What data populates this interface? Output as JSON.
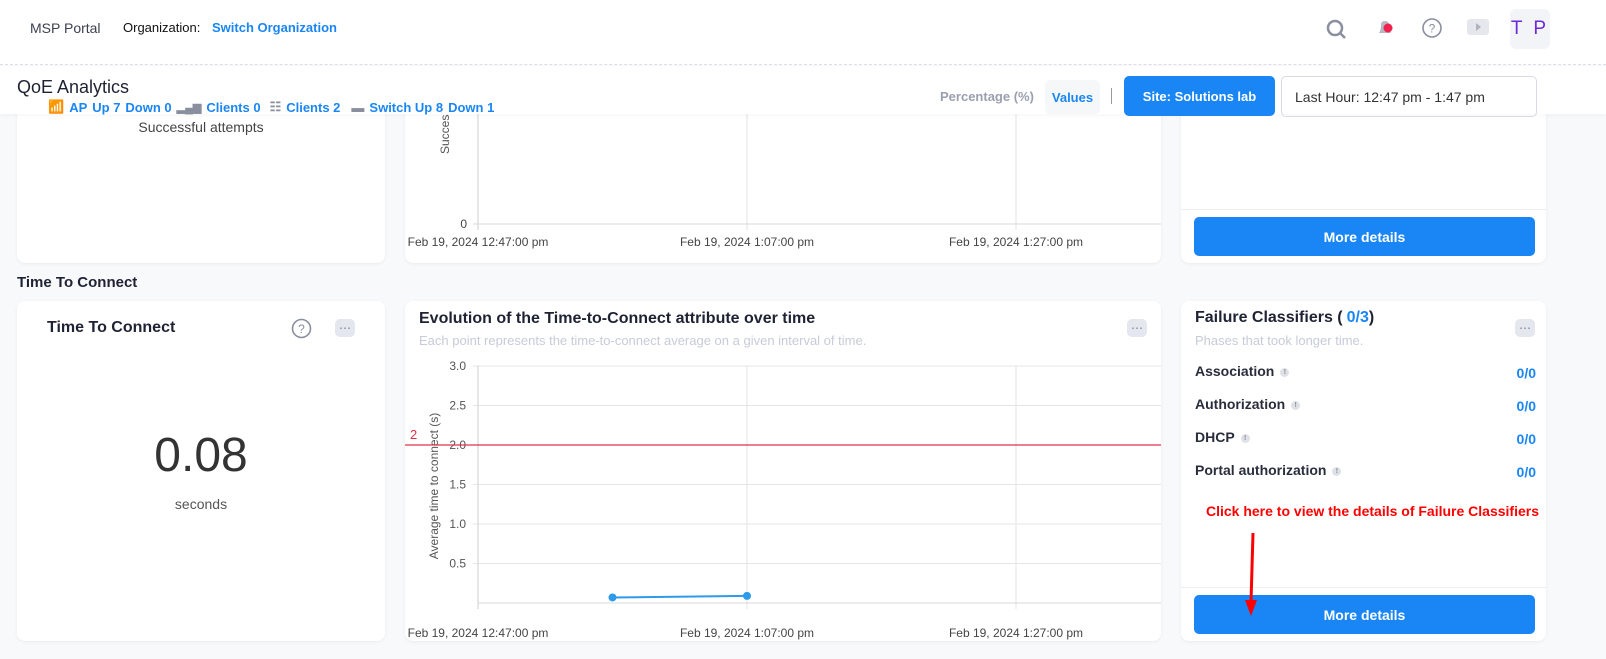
{
  "header": {
    "app": "MSP Portal",
    "org_label": "Organization:",
    "org_link": "Switch Organization",
    "avatar": "T P"
  },
  "subheader": {
    "title": "QoE Analytics",
    "stats": {
      "ap": "AP",
      "ap_up": "Up 7",
      "ap_down": "Down 0",
      "clients_wireless": "Clients 0",
      "clients_wired": "Clients 2",
      "switch_up": "Switch Up 8",
      "switch_down": "Down 1"
    },
    "toggle_percentage": "Percentage (%)",
    "toggle_values": "Values",
    "site_button": "Site: Solutions lab",
    "time_range": "Last Hour: 12:47 pm - 1:47 pm"
  },
  "top_row": {
    "left_caption": "Successful attempts",
    "chart_ylabel": "Successful",
    "more_details": "More details"
  },
  "section_title": "Time To Connect",
  "ttc_card": {
    "title": "Time To Connect",
    "value": "0.08",
    "unit": "seconds"
  },
  "evolution_card": {
    "title": "Evolution of the Time-to-Connect attribute over time",
    "subtitle": "Each point represents the time-to-connect average on a given interval of time."
  },
  "failure_card": {
    "title_prefix": "Failure Classifiers (",
    "count": "0/3",
    "title_suffix": ")",
    "subtitle": "Phases that took longer time.",
    "rows": [
      {
        "label": "Association",
        "value": "0/0"
      },
      {
        "label": "Authorization",
        "value": "0/0"
      },
      {
        "label": "DHCP",
        "value": "0/0"
      },
      {
        "label": "Portal authorization",
        "value": "0/0"
      }
    ],
    "more_details": "More details"
  },
  "annotation": {
    "text": "Click here to view the details of Failure Classifiers",
    "color": "#ff0000"
  },
  "chart_data": [
    {
      "type": "line",
      "ylabel": "Successful",
      "yticks": [
        "0"
      ],
      "xticks": [
        "Feb 19, 2024 12:47:00 pm",
        "Feb 19, 2024 1:07:00 pm",
        "Feb 19, 2024 1:27:00 pm"
      ],
      "series": []
    },
    {
      "type": "line",
      "ylabel": "Average time to connect (s)",
      "ylim": [
        0,
        3.0
      ],
      "yticks": [
        "0.5",
        "1.0",
        "1.5",
        "2.0",
        "2.5",
        "3.0"
      ],
      "xticks": [
        "Feb 19, 2024 12:47:00 pm",
        "Feb 19, 2024 1:07:00 pm",
        "Feb 19, 2024 1:27:00 pm"
      ],
      "threshold": {
        "value": 2,
        "label": "2",
        "color": "#e0314b"
      },
      "series": [
        {
          "color": "#2e9be8",
          "points": [
            {
              "x": "12:57 pm",
              "x_min": 10,
              "y": 0.07
            },
            {
              "x": "1:07 pm",
              "x_min": 20,
              "y": 0.09
            }
          ]
        }
      ]
    }
  ]
}
